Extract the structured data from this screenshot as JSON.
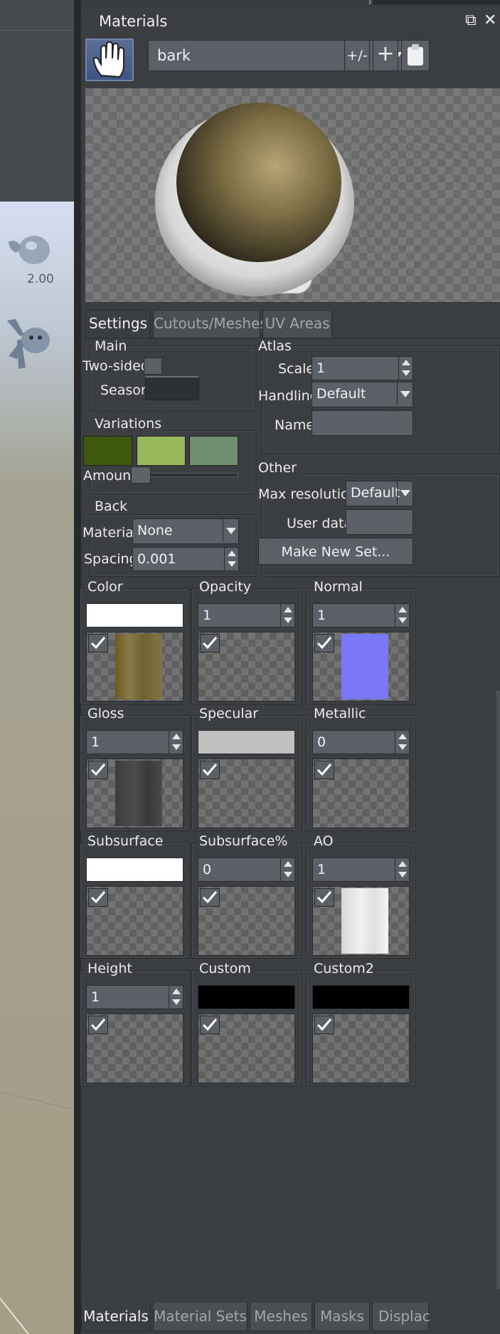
{
  "viewport": {
    "value_label": "2.00"
  },
  "panel": {
    "title": "Materials",
    "restore_glyph": "⧉",
    "close_glyph": "✕",
    "material_select": {
      "value": "bark"
    },
    "buttons": {
      "plus_minus": "+/-",
      "add": "+",
      "paste_icon": "clipboard-icon"
    },
    "tabs": [
      "Settings",
      "Cutouts/Meshes",
      "UV Areas"
    ],
    "main": {
      "title": "Main",
      "two_sided_label": "Two-sided",
      "season_label": "Season"
    },
    "atlas": {
      "title": "Atlas",
      "scale_label": "Scale",
      "scale_value": "1",
      "handling_label": "Handling",
      "handling_value": "Default",
      "name_label": "Name",
      "name_value": ""
    },
    "variations": {
      "title": "Variations",
      "colors": [
        "#3f5a0e",
        "#97b95a",
        "#708f70"
      ],
      "amount_label": "Amount"
    },
    "other": {
      "title": "Other",
      "max_resolution_label": "Max resolution",
      "max_resolution_value": "Default",
      "user_data_label": "User data",
      "user_data_value": "",
      "make_new_set_label": "Make New Set..."
    },
    "back": {
      "title": "Back",
      "material_label": "Material",
      "material_value": "None",
      "spacing_label": "Spacing",
      "spacing_value": "0.001"
    },
    "channels": [
      {
        "label": "Color",
        "input": "swatch",
        "swatch_color": "#ffffff",
        "value": "",
        "texture": "bark-color"
      },
      {
        "label": "Opacity",
        "input": "spin",
        "value": "1",
        "texture": ""
      },
      {
        "label": "Normal",
        "input": "spin",
        "value": "1",
        "texture": "bark-normal"
      },
      {
        "label": "Gloss",
        "input": "spin",
        "value": "1",
        "texture": "bark-gloss"
      },
      {
        "label": "Specular",
        "input": "swatch",
        "swatch_color": "#c1c1c1",
        "value": "",
        "texture": ""
      },
      {
        "label": "Metallic",
        "input": "spin",
        "value": "0",
        "texture": ""
      },
      {
        "label": "Subsurface",
        "input": "swatch",
        "swatch_color": "#ffffff",
        "value": "",
        "texture": ""
      },
      {
        "label": "Subsurface%",
        "input": "spin",
        "value": "0",
        "texture": ""
      },
      {
        "label": "AO",
        "input": "spin",
        "value": "1",
        "texture": "bark-ao"
      },
      {
        "label": "Height",
        "input": "spin",
        "value": "1",
        "texture": ""
      },
      {
        "label": "Custom",
        "input": "swatch",
        "swatch_color": "#000000",
        "value": "",
        "texture": ""
      },
      {
        "label": "Custom2",
        "input": "swatch",
        "swatch_color": "#000000",
        "value": "",
        "texture": ""
      }
    ],
    "bottom_tabs": [
      "Materials",
      "Material Sets",
      "Meshes",
      "Masks",
      "Displac"
    ]
  }
}
